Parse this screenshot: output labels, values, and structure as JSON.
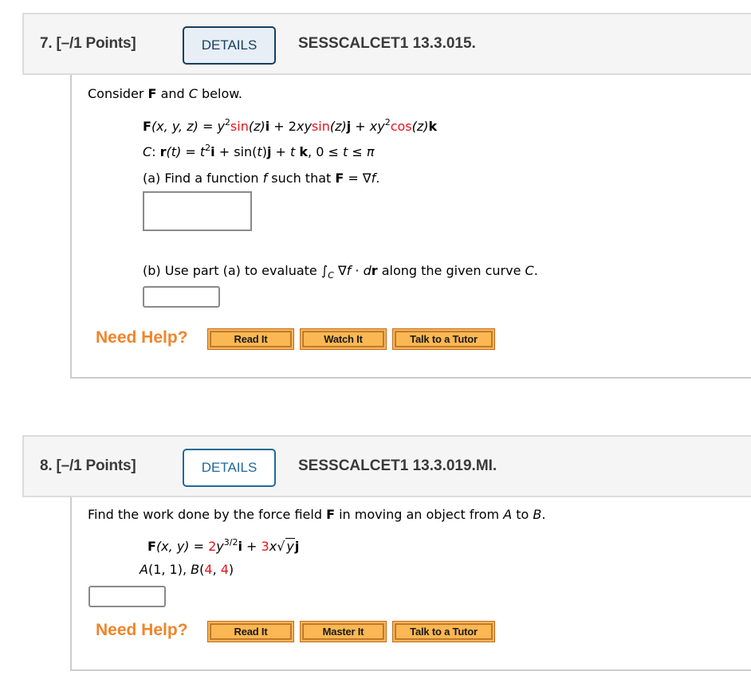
{
  "questions": [
    {
      "number_label": "7.  [–/1 Points]",
      "details_label": "DETAILS",
      "details_state": "active",
      "code": "SESSCALCET1 13.3.015.",
      "intro": {
        "prefix": "Consider ",
        "F": "F",
        "and": " and ",
        "C": "C",
        "suffix": " below."
      },
      "field_line": {
        "lhs_F": "F",
        "lhs_args": "(x, y, z) = ",
        "t1_var": "y",
        "t1_exp": "2",
        "t1_fn": "sin",
        "t1_arg": "(z)",
        "t1_unit": "i",
        "plus1": " + 2",
        "t2_var": "xy",
        "t2_fn": "sin",
        "t2_arg": "(z)",
        "t2_unit": "j",
        "plus2": " + ",
        "t3_var": "xy",
        "t3_exp": "2",
        "t3_fn": "cos",
        "t3_arg": "(z)",
        "t3_unit": "k"
      },
      "curve_line": {
        "C": "C",
        "colon": ": ",
        "r": "r",
        "rt": "(t) = ",
        "t1": "t",
        "t1_exp": "2",
        "i": "i",
        "mid1": " + sin(",
        "t2": "t",
        "mid2": ")",
        "j": "j",
        "mid3": " + ",
        "t3": "t",
        "space": " ",
        "k": "k",
        "range": ", 0 ≤ ",
        "t4": "t",
        "range2": " ≤ ",
        "pi": "π"
      },
      "part_a": {
        "prefix": "(a) Find a function ",
        "f": "f",
        "mid": " such that ",
        "F": "F",
        "eq": " = ∇",
        "f2": "f",
        "end": "."
      },
      "part_a_answer": "",
      "part_b": {
        "prefix": "(b) Use part (a) to evaluate ",
        "integral": "∫",
        "sub_C": "C",
        "nabla": " ∇",
        "f": "f",
        "dot": " · ",
        "d": "d",
        "r": "r",
        "suffix": " along the given curve ",
        "C": "C",
        "end": "."
      },
      "part_b_answer": "",
      "need_help": "Need Help?",
      "help_buttons": [
        "Read It",
        "Watch It",
        "Talk to a Tutor"
      ]
    },
    {
      "number_label": "8.  [–/1 Points]",
      "details_label": "DETAILS",
      "details_state": "normal",
      "code": "SESSCALCET1 13.3.019.MI.",
      "intro": {
        "prefix": "Find the work done by the force field ",
        "F": "F",
        "mid": " in moving an object from ",
        "A": "A",
        "to": " to ",
        "B": "B",
        "end": "."
      },
      "field_line": {
        "lhs_F": "F",
        "lhs_args": "(x, y) = ",
        "c1": "2",
        "v1": "y",
        "exp1": "3/2",
        "i": "i",
        "plus": " + ",
        "c2": "3",
        "v2": "x",
        "sqrt_sym": "√",
        "radicand": "y",
        "j": "j"
      },
      "points_line": {
        "A": "A",
        "A_coords": "(1, 1), ",
        "B": "B",
        "open": "(",
        "bx": "4",
        "comma": ", ",
        "by": "4",
        "close": ")"
      },
      "answer": "",
      "need_help": "Need Help?",
      "help_buttons": [
        "Read It",
        "Master It",
        "Talk to a Tutor"
      ]
    }
  ],
  "colors": {
    "red_param": "#e8131b",
    "need_help": "#f0852a",
    "help_button": "#f7a43d",
    "details_border": "#1a4d6e",
    "header_bg": "#f5f5f5"
  }
}
